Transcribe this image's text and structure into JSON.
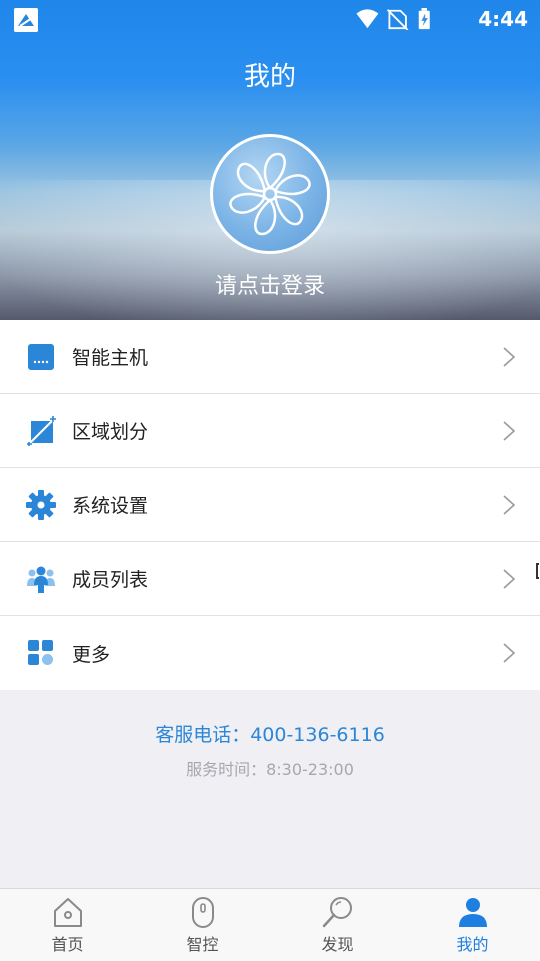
{
  "status_bar": {
    "time": "4:44",
    "icons": [
      "app-icon",
      "wifi-icon",
      "no-sim-icon",
      "battery-charging-icon"
    ]
  },
  "header": {
    "title": "我的",
    "login_prompt": "请点击登录"
  },
  "menu": {
    "items": [
      {
        "label": "智能主机",
        "icon": "smart-host-icon"
      },
      {
        "label": "区域划分",
        "icon": "area-division-icon"
      },
      {
        "label": "系统设置",
        "icon": "gear-icon"
      },
      {
        "label": "成员列表",
        "icon": "members-icon"
      },
      {
        "label": "更多",
        "icon": "more-grid-icon"
      }
    ]
  },
  "service": {
    "phone": "客服电话：400-136-6116",
    "hours": "服务时间：8:30-23:00"
  },
  "tabbar": {
    "tabs": [
      {
        "label": "首页",
        "icon": "home-icon",
        "active": false
      },
      {
        "label": "智控",
        "icon": "mouse-icon",
        "active": false
      },
      {
        "label": "发现",
        "icon": "search-icon",
        "active": false
      },
      {
        "label": "我的",
        "icon": "person-icon",
        "active": true
      }
    ]
  },
  "colors": {
    "accent": "#1e7fe0",
    "icon_blue": "#2b86d8",
    "background": "#efeff4"
  }
}
